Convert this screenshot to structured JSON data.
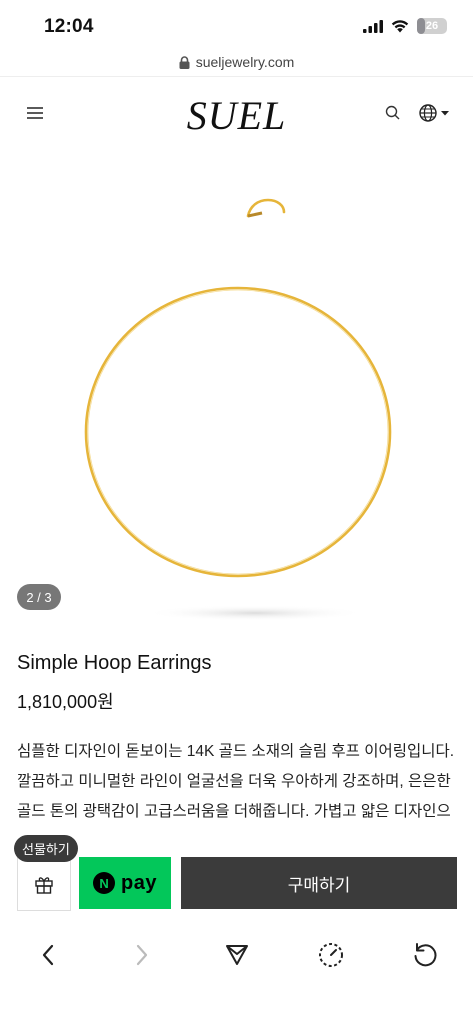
{
  "status_bar": {
    "time": "12:04",
    "battery": "26"
  },
  "browser": {
    "url": "sueljewelry.com"
  },
  "header": {
    "logo": "SUEL"
  },
  "gallery": {
    "counter": "2 / 3"
  },
  "product": {
    "name": "Simple Hoop Earrings",
    "price": "1,810,000원",
    "description": "심플한 디자인이 돋보이는 14K 골드 소재의 슬림 후프 이어링입니다.\n깔끔하고 미니멀한 라인이 얼굴선을 더욱 우아하게 강조하며, 은은한 골드 톤의 광택감이 고급스러움을 더해줍니다. 가볍고 얇은 디자인으"
  },
  "purchase_bar": {
    "gift_tooltip": "선물하기",
    "npay_label": "pay",
    "purchase_label": "구매하기"
  },
  "colors": {
    "accent_dark": "#3b3b3b",
    "npay_green": "#03c75a",
    "gold": "#e6b53a"
  }
}
